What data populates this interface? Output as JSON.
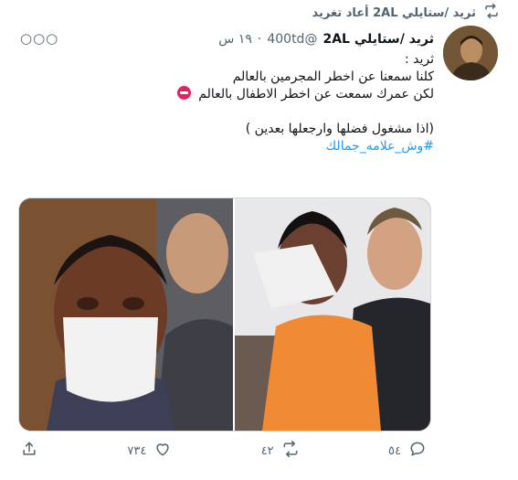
{
  "retweet_banner": {
    "text": "ثريد /ستايلي 2AL أعاد تغريد"
  },
  "tweet": {
    "display_name": "ثريد /ستايلي 2AL",
    "handle": "@400td",
    "dot": "·",
    "time": "١٩ س",
    "lines": [
      "ثريد :",
      "كلنا سمعنا عن اخطر المجرمين بالعالم",
      "لكن عمرك سمعت عن اخطر الاطفال بالعالم"
    ],
    "line_after_gap": "(اذا مشغول فضلها وارجعلها بعدين )",
    "hashtag": "#وش_علامه_جمالك"
  },
  "actions": {
    "reply_count": "٥٤",
    "retweet_count": "٤٢",
    "like_count": "٧٣٤"
  },
  "colors": {
    "link": "#1d9bf0",
    "muted": "#536471",
    "no_entry": "#e0245e"
  },
  "icons": [
    "retweet-icon",
    "more-icon",
    "no-entry-icon",
    "reply-icon",
    "like-icon",
    "share-icon"
  ]
}
